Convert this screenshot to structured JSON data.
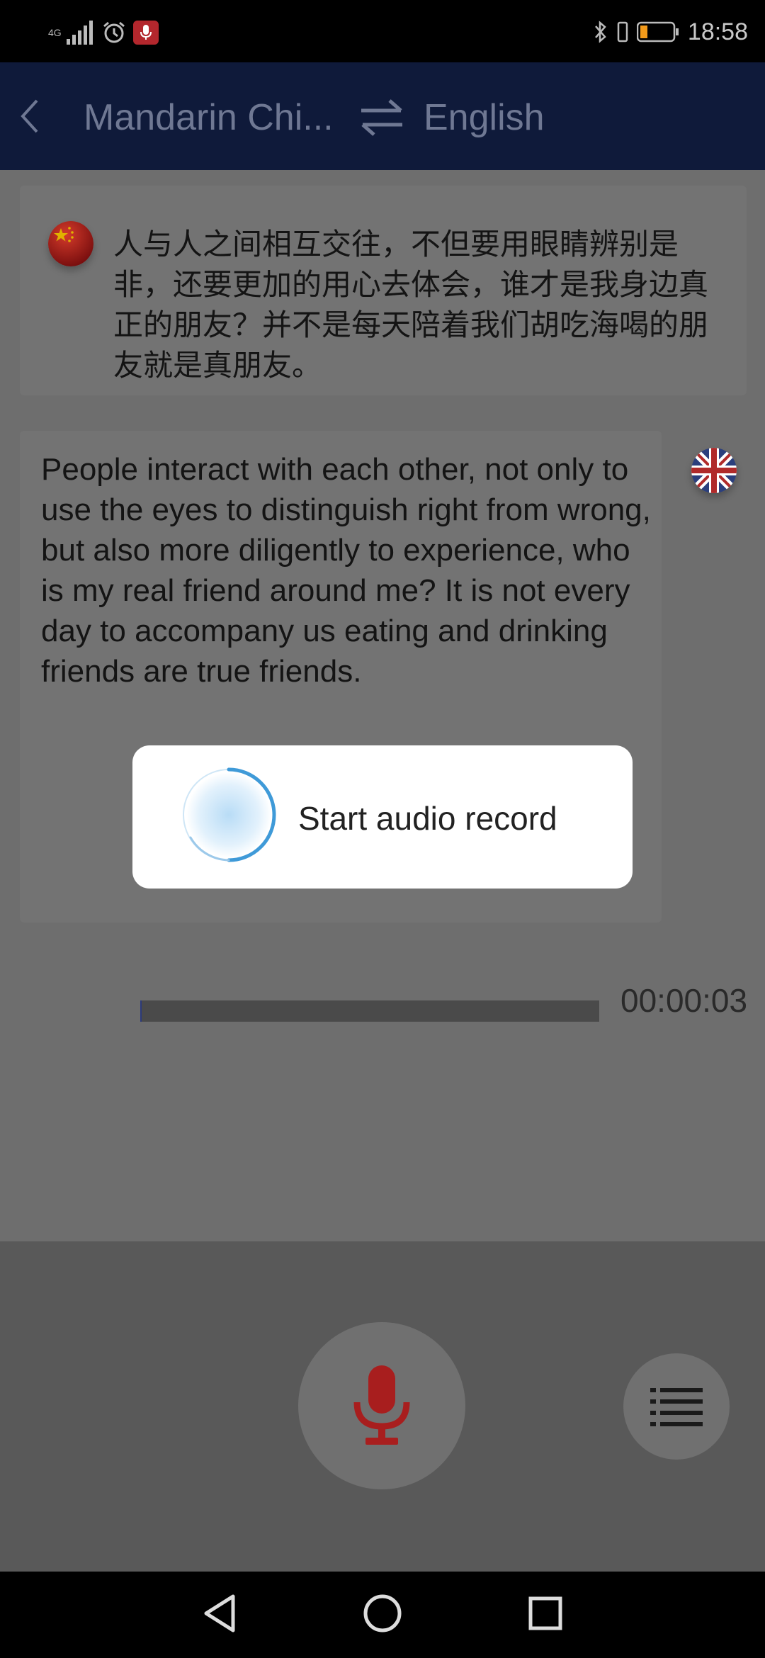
{
  "status_bar": {
    "network": "4G",
    "time": "18:58"
  },
  "header": {
    "source_language": "Mandarin Chi...",
    "target_language": "English"
  },
  "conversation": {
    "source_text": "人与人之间相互交往，不但要用眼睛辨别是非，还要更加的用心去体会，谁才是我身边真正的朋友？并不是每天陪着我们胡吃海喝的朋友就是真朋友。",
    "translated_text": "People interact with each other, not only to use the eyes to distinguish right from wrong, but also more diligently to experience, who is my real friend around me? It is not every day to accompany us eating and drinking friends are true friends."
  },
  "recording": {
    "elapsed": "00:00:03",
    "progress": 0
  },
  "dialog": {
    "message": "Start audio record"
  },
  "icons": {
    "back": "chevron-left-icon",
    "swap": "swap-arrows-icon",
    "mic": "microphone-icon",
    "list": "list-icon",
    "nav_back": "triangle-back-icon",
    "nav_home": "circle-home-icon",
    "nav_recents": "square-recents-icon"
  },
  "colors": {
    "header_bg": "#0f1a3a",
    "header_text": "#6f7893",
    "mic_red": "#a81e1e",
    "overlay_gray": "#6e6e6e",
    "spinner_blue": "#4aa3e0"
  }
}
